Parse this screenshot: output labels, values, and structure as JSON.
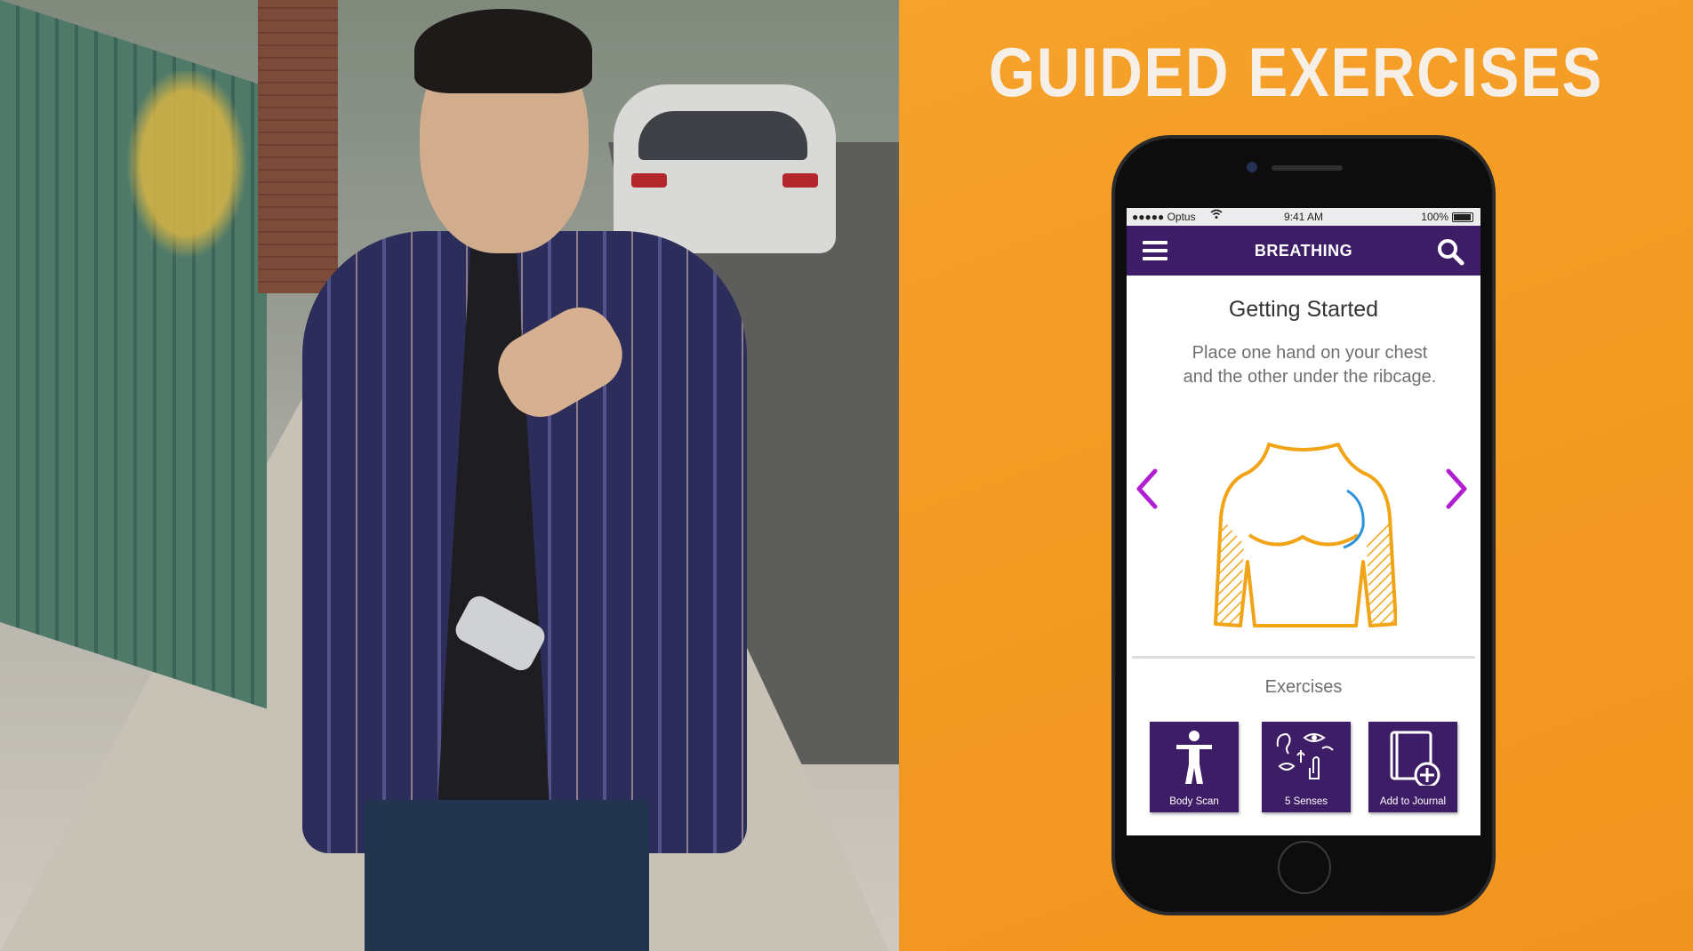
{
  "headline": "GUIDED EXERCISES",
  "status_bar": {
    "carrier": "●●●●● Optus",
    "time": "9:41 AM",
    "battery": "100%"
  },
  "nav": {
    "title": "BREATHING"
  },
  "content": {
    "title": "Getting Started",
    "description": "Place one hand on your chest and the other under the ribcage."
  },
  "exercises": {
    "label": "Exercises",
    "tiles": [
      {
        "label": "Body Scan",
        "icon": "person-icon"
      },
      {
        "label": "5 Senses",
        "icon": "senses-icon"
      },
      {
        "label": "Add to Journal",
        "icon": "journal-add-icon"
      }
    ]
  },
  "colors": {
    "accent_orange": "#f49a25",
    "brand_purple": "#3d1d66",
    "arrow_magenta": "#b01fd1",
    "illustration_orange": "#f2a417",
    "breath_blue": "#2a92d8"
  }
}
